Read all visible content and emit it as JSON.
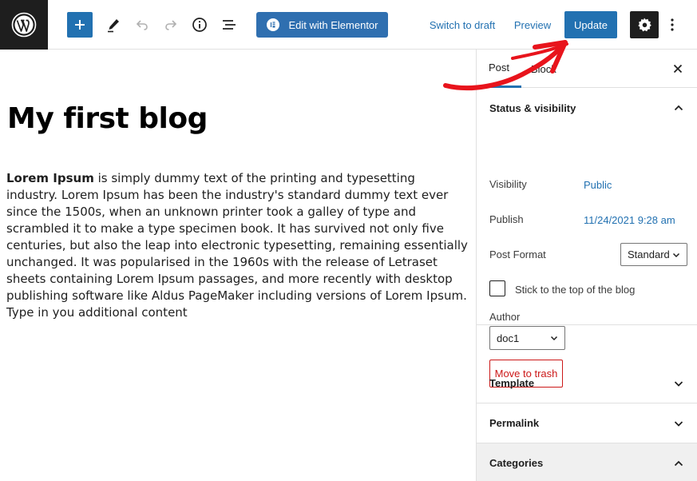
{
  "toolbar": {
    "elementor_label": "Edit with Elementor",
    "switch_draft_label": "Switch to draft",
    "preview_label": "Preview",
    "update_label": "Update"
  },
  "editor": {
    "title": "My first blog",
    "body_bold": "Lorem Ipsum",
    "body_text": " is simply dummy text of the printing and typesetting industry. Lorem Ipsum has been the industry's standard dummy text ever since the 1500s, when an unknown printer took a galley of type and scrambled it to make a type specimen book. It has survived not only five centuries, but also the leap into electronic typesetting, remaining essentially unchanged. It was popularised in the 1960s with the release of Letraset sheets containing Lorem Ipsum passages, and more recently with desktop publishing software like Aldus PageMaker including versions of Lorem Ipsum. Type in you additional content"
  },
  "sidebar": {
    "tabs": [
      {
        "label": "Post"
      },
      {
        "label": "Block"
      }
    ],
    "status_visibility": {
      "heading": "Status & visibility",
      "visibility_label": "Visibility",
      "visibility_value": "Public",
      "publish_label": "Publish",
      "publish_value": "11/24/2021 9:28 am",
      "post_format_label": "Post Format",
      "post_format_value": "Standard",
      "sticky_label": "Stick to the top of the blog",
      "author_label": "Author",
      "author_value": "doc1",
      "trash_label": "Move to trash"
    },
    "template_heading": "Template",
    "permalink_heading": "Permalink",
    "categories_heading": "Categories"
  },
  "colors": {
    "accent": "#2271b1",
    "danger": "#cc1818",
    "annotation_arrow": "#e8141c"
  },
  "icons": [
    "wordpress-logo",
    "plus-icon",
    "pencil-icon",
    "undo-icon",
    "redo-icon",
    "info-icon",
    "list-view-icon",
    "elementor-icon",
    "gear-icon",
    "more-vertical-icon",
    "close-icon",
    "chevron-up-icon",
    "chevron-down-icon"
  ]
}
